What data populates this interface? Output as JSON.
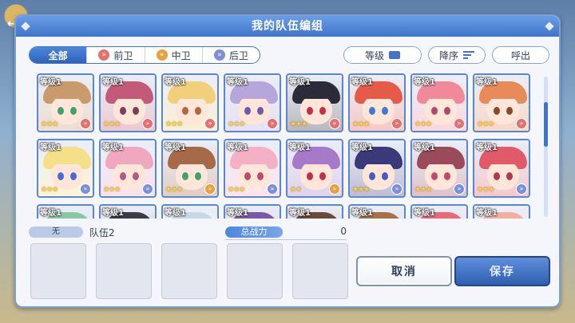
{
  "window": {
    "title": "我的队伍编组"
  },
  "filters": [
    {
      "label": "全部",
      "active": true,
      "icon": ""
    },
    {
      "label": "前卫",
      "active": false,
      "icon": "front-position-icon"
    },
    {
      "label": "中卫",
      "active": false,
      "icon": "middle-position-icon"
    },
    {
      "label": "后卫",
      "active": false,
      "icon": "back-position-icon"
    }
  ],
  "toolbar": {
    "sort_label": "等级",
    "order_label": "降序",
    "summon_label": "呼出"
  },
  "characters": [
    {
      "level": "等级1",
      "stars": "★★★",
      "hair": "#c99a6b",
      "eyes": "#3fa46b",
      "pos": "front"
    },
    {
      "level": "等级1",
      "stars": "★★★",
      "hair": "#c45a7a",
      "eyes": "#7a3f5c",
      "pos": "front"
    },
    {
      "level": "等级1",
      "stars": "★★★",
      "hair": "#f0d07a",
      "eyes": "#b06a3a",
      "pos": "front"
    },
    {
      "level": "等级1",
      "stars": "★★★",
      "hair": "#b6a6dc",
      "eyes": "#6a5ab0",
      "pos": "front"
    },
    {
      "level": "等级1",
      "stars": "★★★",
      "hair": "#2b2b3a",
      "eyes": "#c0304a",
      "pos": "front"
    },
    {
      "level": "等级1",
      "stars": "★★★",
      "hair": "#e65a4a",
      "eyes": "#3f7ad0",
      "pos": "front"
    },
    {
      "level": "等级1",
      "stars": "★★★",
      "hair": "#f08a9a",
      "eyes": "#b04a6a",
      "pos": "front"
    },
    {
      "level": "等级1",
      "stars": "★★★",
      "hair": "#e88a5a",
      "eyes": "#8a4a2a",
      "pos": "front"
    },
    {
      "level": "等级1",
      "stars": "★★★",
      "hair": "#f5e08a",
      "eyes": "#4a6ad0",
      "pos": "back"
    },
    {
      "level": "等级1",
      "stars": "★★★",
      "hair": "#f0a8c0",
      "eyes": "#b05a8a",
      "pos": "back"
    },
    {
      "level": "等级1",
      "stars": "★★★",
      "hair": "#a66a4a",
      "eyes": "#3fa46b",
      "pos": "middle"
    },
    {
      "level": "等级1",
      "stars": "★★★",
      "hair": "#f4b0c4",
      "eyes": "#c04a6a",
      "pos": "back"
    },
    {
      "level": "等级1",
      "stars": "★★",
      "hair": "#a67ac8",
      "eyes": "#c0304a",
      "pos": "middle"
    },
    {
      "level": "等级1",
      "stars": "★★★",
      "hair": "#3a3a7a",
      "eyes": "#4a5ac0",
      "pos": "back"
    },
    {
      "level": "等级1",
      "stars": "★★★",
      "hair": "#9a4a5a",
      "eyes": "#c04a6a",
      "pos": "back"
    },
    {
      "level": "等级1",
      "stars": "★★★",
      "hair": "#e05a6a",
      "eyes": "#b03a4a",
      "pos": "back"
    },
    {
      "level": "等级1",
      "stars": "",
      "hair": "#8ac8a4",
      "eyes": "#3a6a5a",
      "pos": ""
    },
    {
      "level": "等级1",
      "stars": "",
      "hair": "#3a3a4a",
      "eyes": "#5a4a6a",
      "pos": ""
    },
    {
      "level": "等级1",
      "stars": "",
      "hair": "#c8d8e8",
      "eyes": "#5a6a8a",
      "pos": ""
    },
    {
      "level": "等级1",
      "stars": "",
      "hair": "#7a5aa6",
      "eyes": "#5a4a8a",
      "pos": ""
    },
    {
      "level": "等级1",
      "stars": "",
      "hair": "#6a4a3a",
      "eyes": "#5a3a2a",
      "pos": ""
    },
    {
      "level": "等级1",
      "stars": "",
      "hair": "#a6704a",
      "eyes": "#6a4a3a",
      "pos": ""
    },
    {
      "level": "等级1",
      "stars": "",
      "hair": "#e86a7a",
      "eyes": "#a04a5a",
      "pos": ""
    },
    {
      "level": "等级1",
      "stars": "",
      "hair": "#f0b0a0",
      "eyes": "#a06a5a",
      "pos": ""
    }
  ],
  "team": {
    "tag": "无",
    "name": "队伍2",
    "power_label": "总战力",
    "power_value": "0"
  },
  "actions": {
    "cancel_label": "取消",
    "save_label": "保存"
  },
  "colors": {
    "accent": "#3f74c8",
    "front": "#e86f6f",
    "middle": "#e6a23c",
    "back": "#7d8fd8"
  }
}
